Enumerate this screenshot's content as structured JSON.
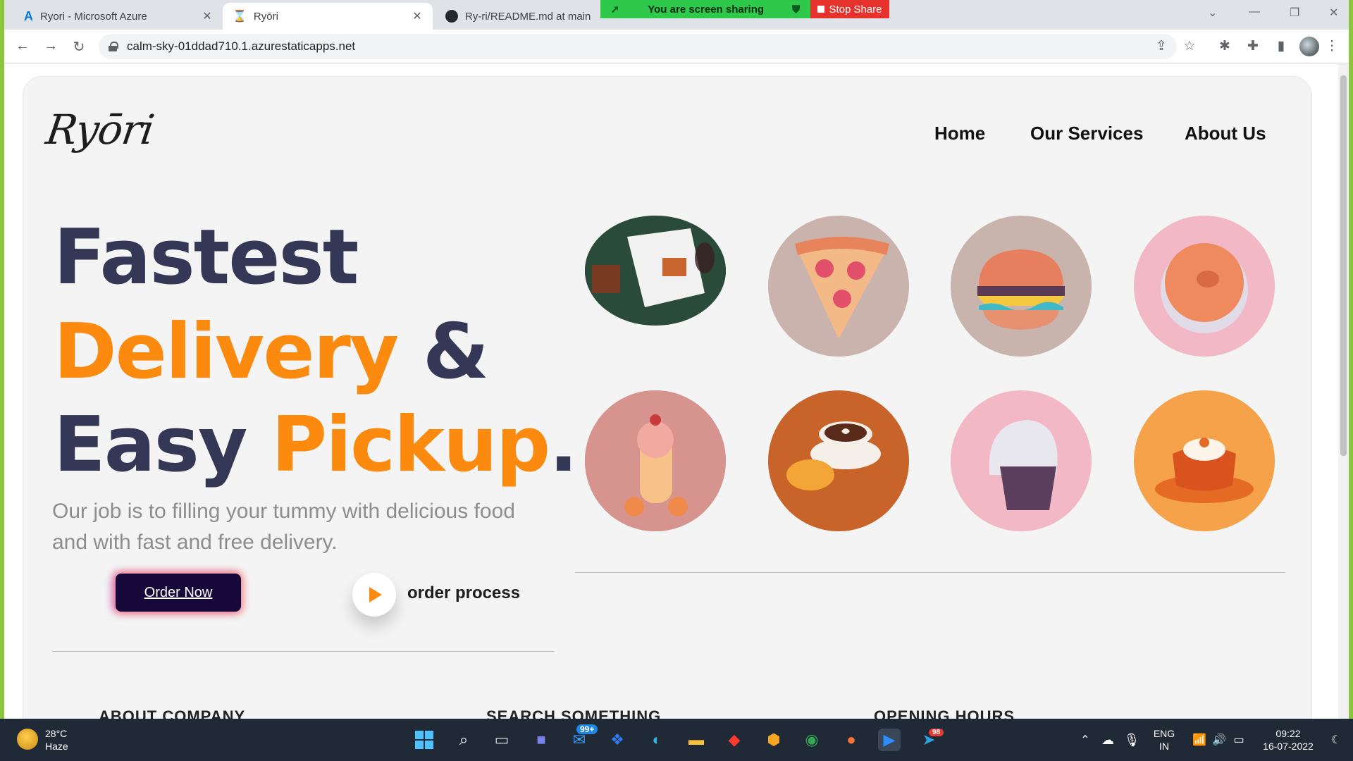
{
  "browser": {
    "tabs": [
      {
        "title": "Ryori - Microsoft Azure",
        "active": false
      },
      {
        "title": "Ryōri",
        "active": true
      },
      {
        "title": "Ry-ri/README.md at main · ka",
        "active": false
      }
    ],
    "url": "calm-sky-01ddad710.1.azurestaticapps.net",
    "share_banner": "You are screen sharing",
    "stop_share": "Stop Share"
  },
  "site": {
    "logo": "Ryōri",
    "nav": [
      "Home",
      "Our Services",
      "About Us"
    ],
    "hero": {
      "line1": "Fastest",
      "line2_orange": "Delivery",
      "line2_navy": "&",
      "line3_navy": "Easy",
      "line3_orange": "Pickup",
      "line3_dot": "."
    },
    "description_line1": "Our job is to filling your tummy with delicious food",
    "description_line2": "and with fast and free delivery.",
    "order_button": "Order Now",
    "order_process": "order process",
    "footer_headings": [
      "ABOUT COMPANY",
      "SEARCH SOMETHING",
      "OPENING HOURS"
    ],
    "food_icons": [
      "menu-board-icon",
      "pizza-slice-icon",
      "burger-icon",
      "donut-icon",
      "ice-cream-icon",
      "coffee-cup-icon",
      "rice-ball-icon",
      "pumpkin-cake-icon"
    ]
  },
  "taskbar": {
    "weather_temp": "28°C",
    "weather_desc": "Haze",
    "mail_badge": "99+",
    "telegram_badge": "98",
    "lang_top": "ENG",
    "lang_bottom": "IN",
    "time": "09:22",
    "date": "16-07-2022"
  },
  "colors": {
    "accent_orange": "#fb8a0e",
    "navy": "#343755",
    "share_green": "#2ec94a",
    "stop_red": "#e5322d"
  }
}
